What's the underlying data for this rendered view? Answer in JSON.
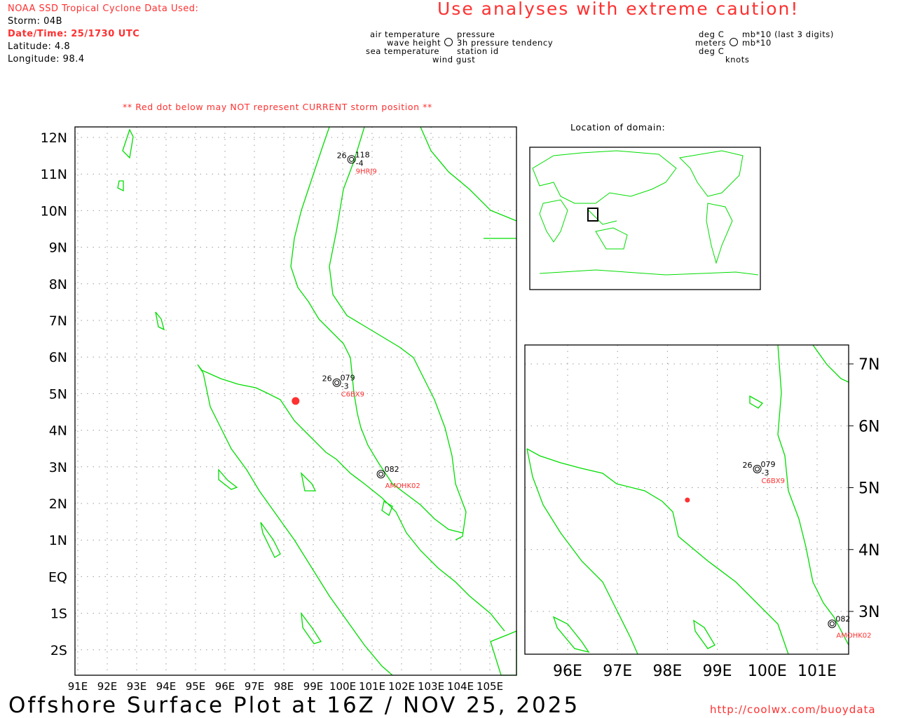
{
  "header": {
    "source": "NOAA SSD Tropical Cyclone Data Used:",
    "storm": "Storm: 04B",
    "datetime": "Date/Time: 25/1730 UTC",
    "latitude": "Latitude: 4.8",
    "longitude": "Longitude: 98.4",
    "caution": "Use analyses with extreme caution!",
    "red_dot_note": "** Red dot below may NOT represent CURRENT storm position **"
  },
  "legend": {
    "left": [
      "air temperature",
      "wave height",
      "sea temperature"
    ],
    "right": [
      "pressure",
      "3h pressure tendency",
      "station id"
    ],
    "bottom": "wind gust",
    "units_left": [
      "deg C",
      "meters",
      "deg C"
    ],
    "units_right": [
      "mb*10 (last 3 digits)",
      "mb*10"
    ],
    "units_bottom": "knots"
  },
  "location_label": "Location of domain:",
  "main_map": {
    "lon_ticks": [
      "91E",
      "92E",
      "93E",
      "94E",
      "95E",
      "96E",
      "97E",
      "98E",
      "99E",
      "100E",
      "101E",
      "102E",
      "103E",
      "104E",
      "105E"
    ],
    "lat_ticks": [
      "12N",
      "11N",
      "10N",
      "9N",
      "8N",
      "7N",
      "6N",
      "5N",
      "4N",
      "3N",
      "2N",
      "1N",
      "EQ",
      "1S",
      "2S"
    ],
    "storm": {
      "lon": 98.4,
      "lat": 4.8
    }
  },
  "zoom_map": {
    "lon_ticks": [
      "96E",
      "97E",
      "98E",
      "99E",
      "100E",
      "101E"
    ],
    "lat_ticks": [
      "7N",
      "6N",
      "5N",
      "4N",
      "3N"
    ]
  },
  "stations": [
    {
      "id": "9HRJ9",
      "air_temp": "26",
      "pressure": "118",
      "tendency": "-4",
      "lon": 100.3,
      "lat": 11.4
    },
    {
      "id": "C6BX9",
      "air_temp": "26",
      "pressure": "079",
      "tendency": "-3",
      "lon": 99.8,
      "lat": 5.3
    },
    {
      "id": "AMOHK02",
      "air_temp": "",
      "pressure": "082",
      "tendency": "",
      "lon": 101.3,
      "lat": 2.8
    }
  ],
  "footer": {
    "title": "Offshore Surface Plot at 16Z / NOV 25, 2025",
    "url": "http://coolwx.com/buoydata"
  },
  "colors": {
    "coast": "#00dd00",
    "alert": "#ff3030",
    "storm": "#ff3030"
  }
}
